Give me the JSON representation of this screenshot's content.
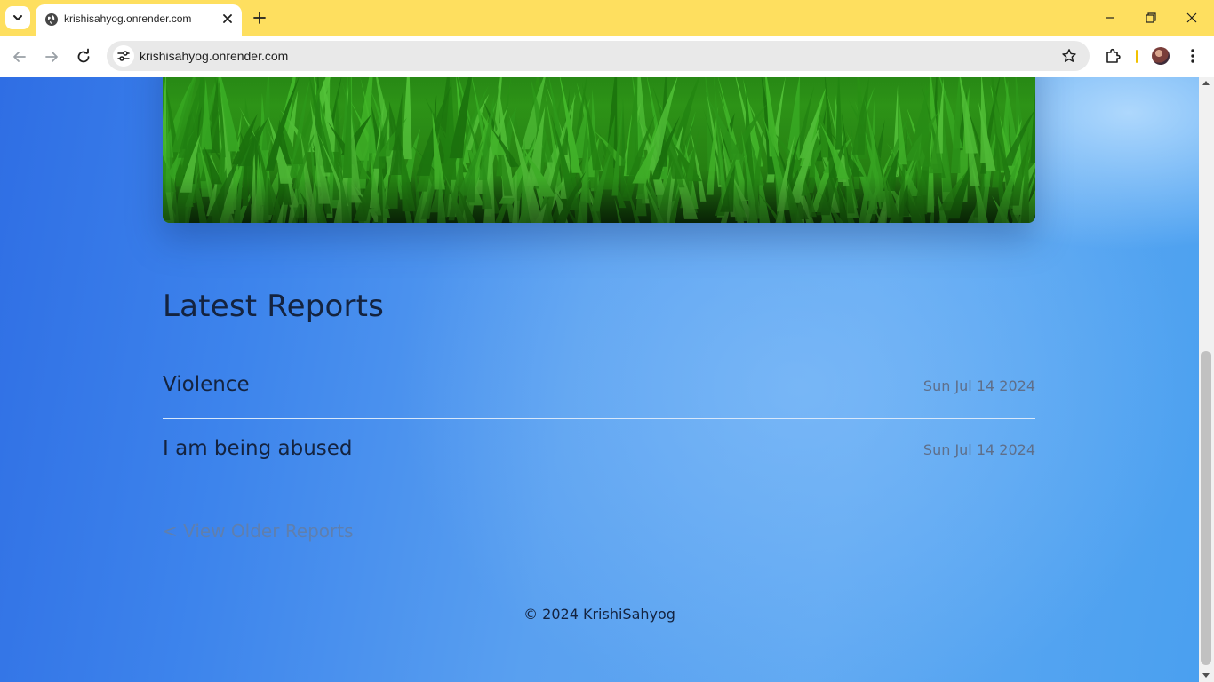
{
  "browser": {
    "tab": {
      "title": "krishisahyog.onrender.com"
    },
    "address_bar": {
      "url": "krishisahyog.onrender.com"
    }
  },
  "page": {
    "hero_image": {
      "alt": "grass"
    },
    "latest_reports": {
      "heading": "Latest Reports",
      "items": [
        {
          "title": "Violence",
          "date": "Sun Jul 14 2024"
        },
        {
          "title": "I am being abused",
          "date": "Sun Jul 14 2024"
        }
      ]
    },
    "older_reports_link": "< View Older Reports",
    "footer": {
      "copyright": "© 2024 KrishiSahyog"
    }
  },
  "colors": {
    "tabbar": "#fedf5f",
    "heading_text": "#14233f",
    "date_text": "#5f6f8a",
    "link_text": "#5f7fae",
    "page_background": "#4a95ee"
  },
  "icons": {
    "tab_search": "chevron-down-icon",
    "favicon": "globe-icon",
    "tab_close": "close-icon",
    "new_tab": "plus-icon",
    "minimize": "minimize-icon",
    "restore": "restore-icon",
    "close_window": "close-icon",
    "back": "arrow-left-icon",
    "forward": "arrow-right-icon",
    "reload": "reload-icon",
    "site_info": "tune-icon",
    "bookmark": "star-icon",
    "extensions": "puzzle-icon",
    "profile": "avatar",
    "menu": "kebab-menu-icon"
  }
}
